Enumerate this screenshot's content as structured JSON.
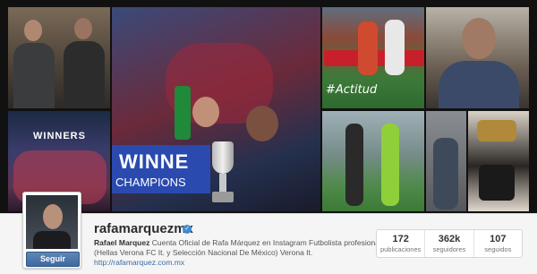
{
  "collage": {
    "winners_text": "WINNERS",
    "banner_winner": "WINNE",
    "banner_champions": "CHAMPIONS",
    "hashtag": "#Actitud"
  },
  "profile": {
    "username": "rafamarquezmx",
    "verified_glyph": "✓",
    "follow_label": "Seguir",
    "full_name": "Rafael Marquez",
    "bio_text": "Cuenta Oficial de Rafa Márquez en Instagram Futbolista profesional (Hellas Verona FC It. y Selección Nacional De México) Verona It.",
    "website": "http://rafamarquez.com.mx"
  },
  "stats": [
    {
      "value": "172",
      "label": "publicaciones"
    },
    {
      "value": "362k",
      "label": "seguidores"
    },
    {
      "value": "107",
      "label": "seguidos"
    }
  ],
  "colors": {
    "follow_button": "#3e6aa0",
    "verified_badge": "#3d8bd1"
  }
}
